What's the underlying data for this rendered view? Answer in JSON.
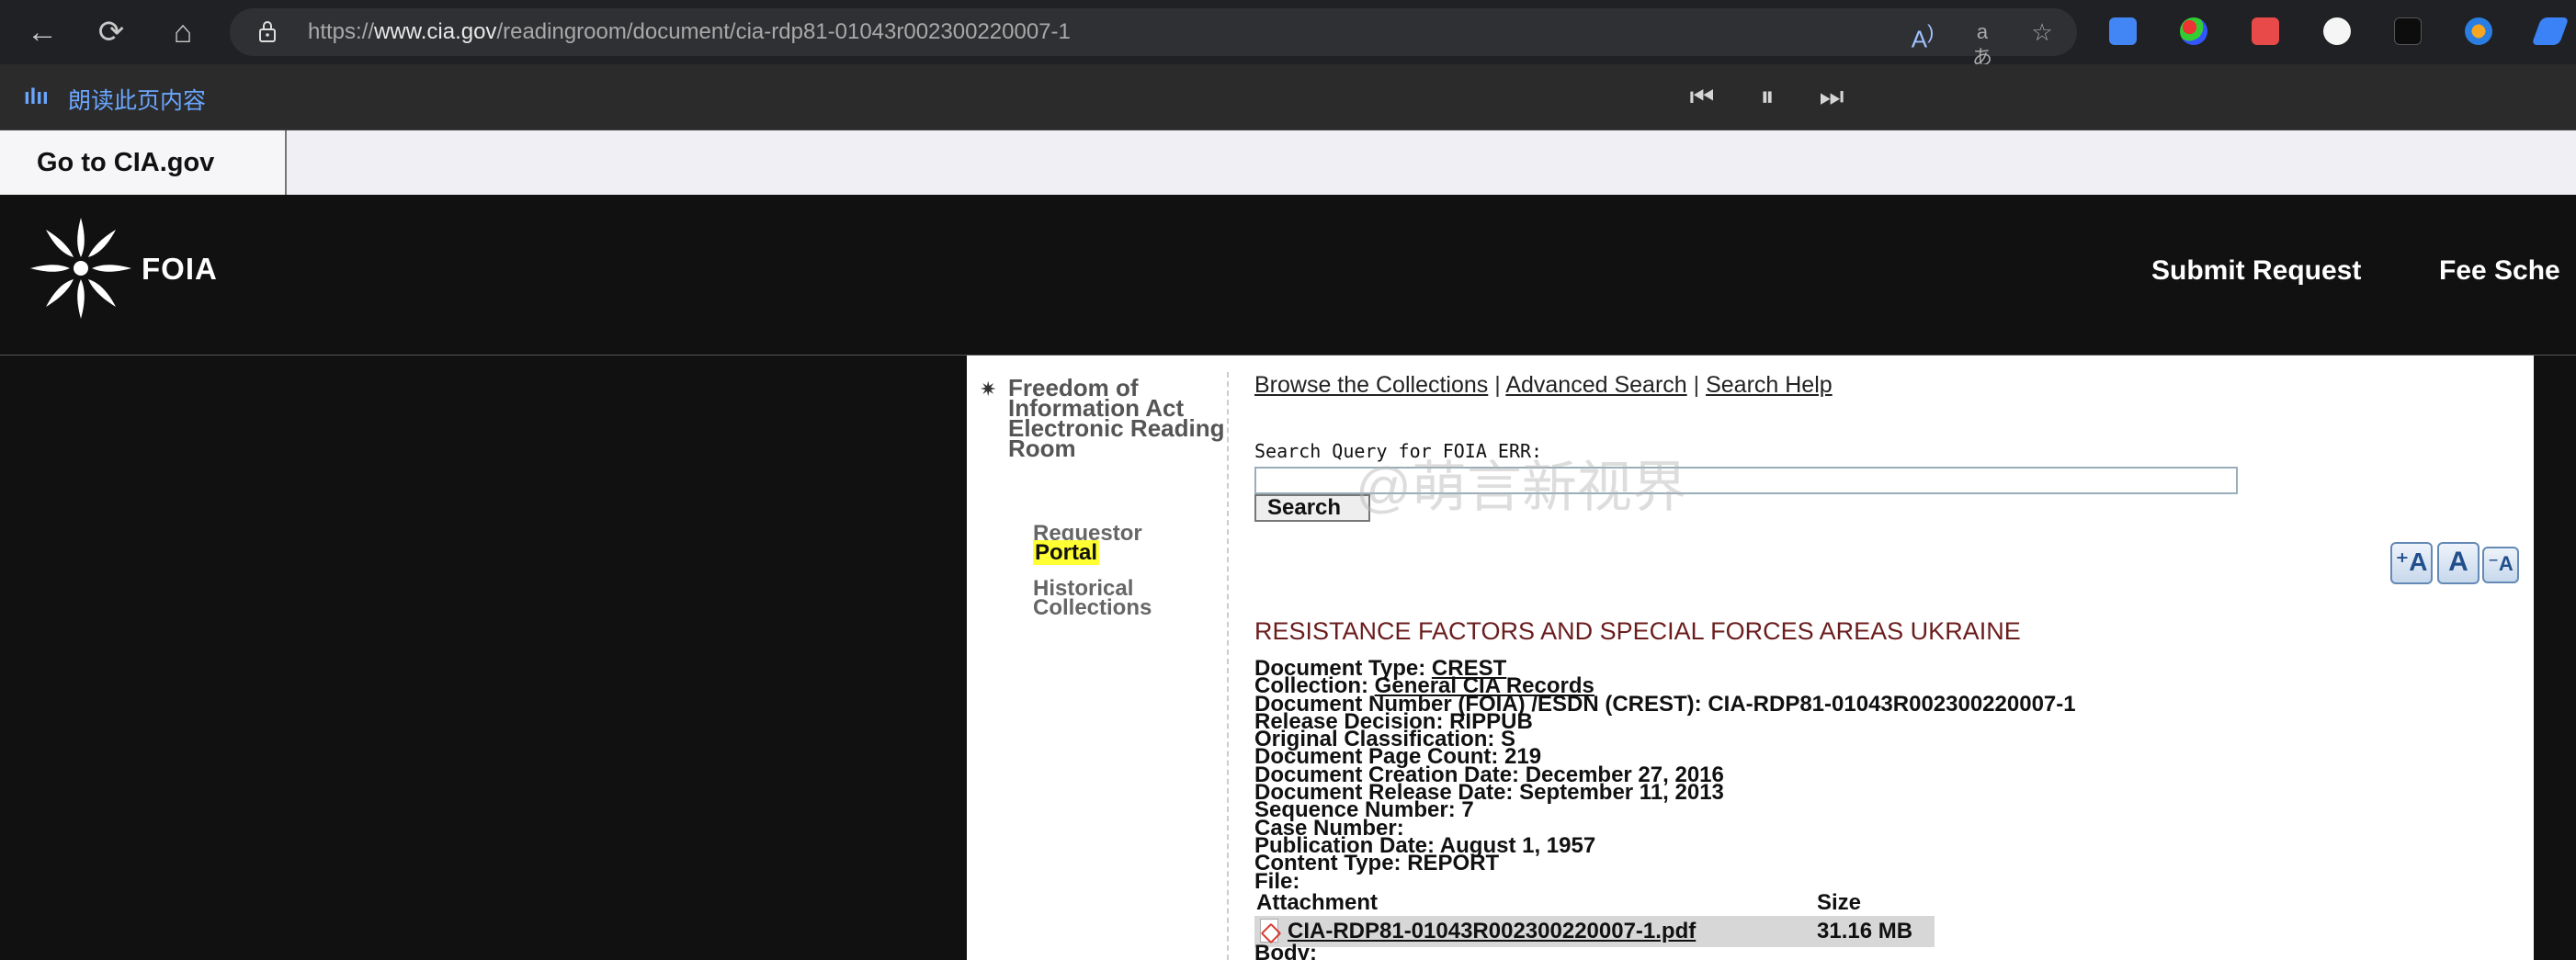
{
  "browser": {
    "url_prefix": "https://",
    "url_domain": "www.cia.gov",
    "url_path": "/readingroom/document/cia-rdp81-01043r002300220007-1",
    "back_icon": "back-arrow-icon",
    "reload_icon": "reload-icon",
    "home_icon": "home-icon",
    "lock_icon": "lock-icon",
    "accent": "#6aa6ff"
  },
  "read_aloud": {
    "label": "朗读此页内容",
    "icon": "read-aloud-icon"
  },
  "cia_bar": {
    "go_to": "Go to CIA.gov"
  },
  "header": {
    "logo_text": "FOIA",
    "nav_submit": "Submit Request",
    "nav_fee": "Fee Sche"
  },
  "sidebar": {
    "title": "Freedom of Information Act Electronic Reading Room",
    "requestor": "Requestor",
    "portal": "Portal",
    "historical": "Historical Collections"
  },
  "search": {
    "browse": "Browse the Collections",
    "advanced": "Advanced Search",
    "help": "Search Help",
    "separator": "|",
    "label": "Search Query for FOIA ERR:",
    "button": "Search",
    "placeholder": ""
  },
  "watermark": "@萌言新视界",
  "document": {
    "title": "RESISTANCE FACTORS AND SPECIAL FORCES AREAS UKRAINE",
    "type_label": "Document Type:",
    "type_value": "CREST",
    "collection_label": "Collection:",
    "collection_value": "General CIA Records",
    "number_line": "Document Number (FOIA) /ESDN (CREST): CIA-RDP81-01043R002300220007-1",
    "release_line": "Release Decision: RIPPUB",
    "classification_line": "Original Classification: S",
    "page_count_line": "Document Page Count: 219",
    "creation_line": "Document Creation Date: December 27, 2016",
    "release_date_line": "Document Release Date: September 11, 2013",
    "sequence_line": "Sequence Number: 7",
    "case_line": "Case Number:",
    "publication_line": "Publication Date: August 1, 1957",
    "content_line": "Content Type: REPORT",
    "file_line": "File:",
    "attachment_header": "Attachment",
    "size_header": "Size",
    "attachment_name": "CIA-RDP81-01043R002300220007-1.pdf",
    "attachment_size": "31.16 MB",
    "body_label": "Body:"
  }
}
